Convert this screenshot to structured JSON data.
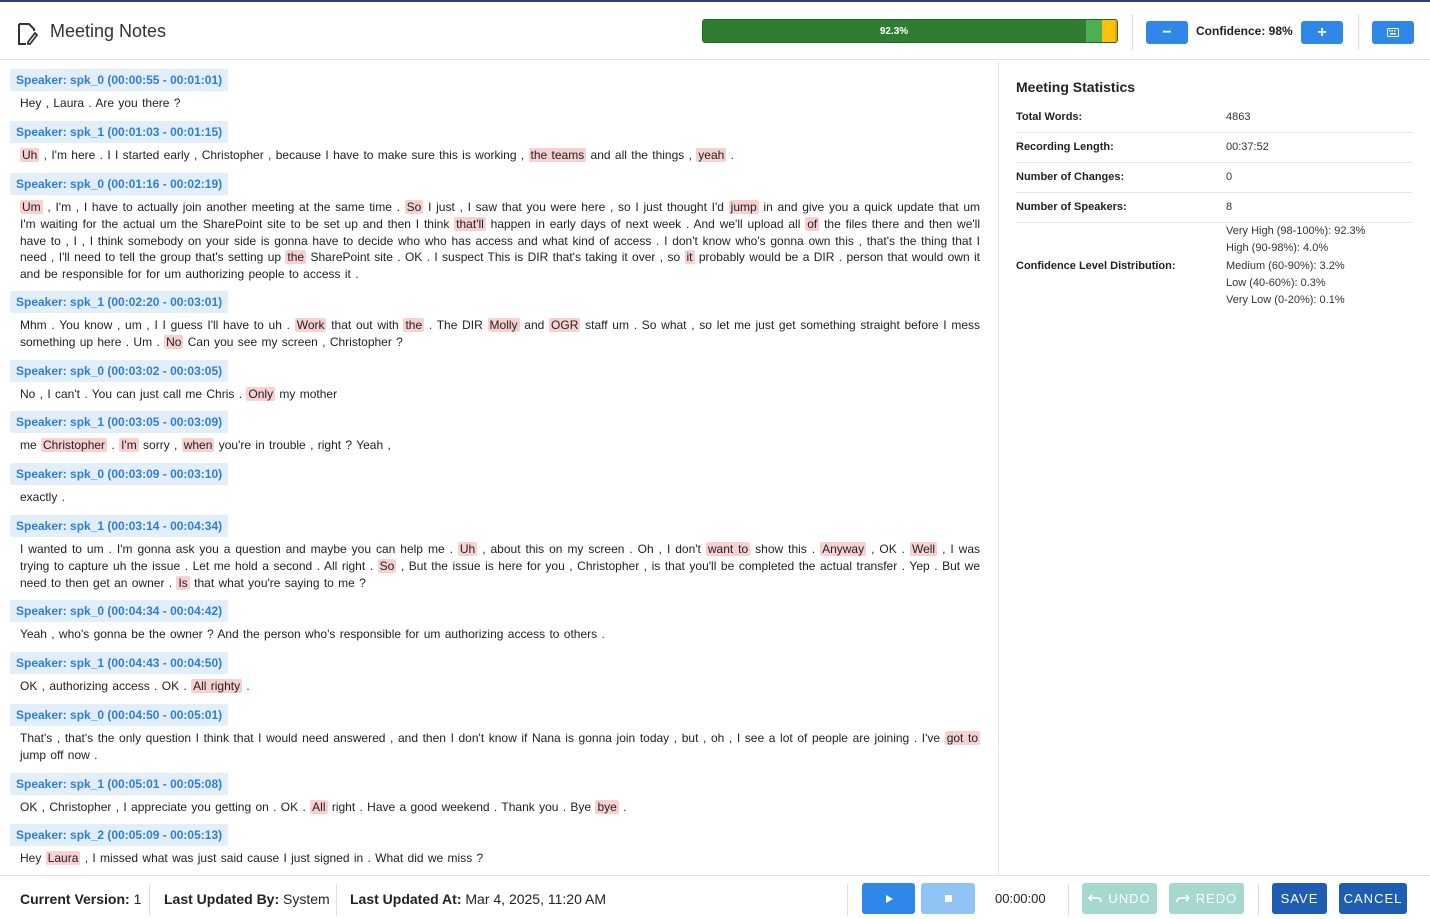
{
  "app": {
    "title": "Meeting Notes",
    "icon": "edit-document-icon"
  },
  "header": {
    "progress_label": "92.3%",
    "distribution_colors": [
      "#2e7d32",
      "#4caf50",
      "#ffc107",
      "#ff9800",
      "#f44336"
    ],
    "confidence_label": "Confidence: 98%",
    "minus_label": "−",
    "plus_label": "+",
    "keyboard_icon": "keyboard-icon"
  },
  "transcript": [
    {
      "speaker": "Speaker: spk_0 (00:00:55 - 00:01:01)",
      "parts": [
        [
          "Hey , Laura . Are you there ?",
          false
        ]
      ]
    },
    {
      "speaker": "Speaker: spk_1 (00:01:03 - 00:01:15)",
      "parts": [
        [
          "Uh",
          true
        ],
        [
          " , I'm here . I I started early , Christopher , because I have to make sure this is working , ",
          false
        ],
        [
          "the teams",
          true
        ],
        [
          " and all the things , ",
          false
        ],
        [
          "yeah",
          true
        ],
        [
          " .",
          false
        ]
      ]
    },
    {
      "speaker": "Speaker: spk_0 (00:01:16 - 00:02:19)",
      "parts": [
        [
          "Um",
          true
        ],
        [
          " , I'm , I have to actually join another meeting at the same time . ",
          false
        ],
        [
          "So",
          true
        ],
        [
          " I just , I saw that you were here , so I just thought I'd ",
          false
        ],
        [
          "jump",
          true
        ],
        [
          " in and give you a quick update that um I'm waiting for the actual um the SharePoint site to be set up and then I think ",
          false
        ],
        [
          "that'll",
          true
        ],
        [
          " happen in early days of next week . And we'll upload all ",
          false
        ],
        [
          "of",
          true
        ],
        [
          " the files there and then we'll have to , I , I think somebody on your side is gonna have to decide who who has access and what kind of access . I don't know who's gonna own this , that's the thing that I need , I'll need to tell the group that's setting up ",
          false
        ],
        [
          "the",
          true
        ],
        [
          " SharePoint site . OK . I suspect This is DIR that's taking it over , so ",
          false
        ],
        [
          "it",
          true
        ],
        [
          " probably would be a DIR . person that would own it and be responsible for for um authorizing people to access it .",
          false
        ]
      ]
    },
    {
      "speaker": "Speaker: spk_1 (00:02:20 - 00:03:01)",
      "parts": [
        [
          "Mhm . You know , um , I I guess I'll have to uh . ",
          false
        ],
        [
          "Work",
          true
        ],
        [
          " that out with ",
          false
        ],
        [
          "the",
          true
        ],
        [
          " . The DIR ",
          false
        ],
        [
          "Molly",
          true
        ],
        [
          " and ",
          false
        ],
        [
          "OGR",
          true
        ],
        [
          " staff um . So what , so let me just get something straight before I mess something up here . Um . ",
          false
        ],
        [
          "No",
          true
        ],
        [
          " Can you see my screen , Christopher ?",
          false
        ]
      ]
    },
    {
      "speaker": "Speaker: spk_0 (00:03:02 - 00:03:05)",
      "parts": [
        [
          "No , I can't . You can just call me Chris . ",
          false
        ],
        [
          "Only",
          true
        ],
        [
          " my mother",
          false
        ]
      ]
    },
    {
      "speaker": "Speaker: spk_1 (00:03:05 - 00:03:09)",
      "parts": [
        [
          "me ",
          false
        ],
        [
          "Christopher",
          true
        ],
        [
          " . ",
          false
        ],
        [
          "I'm",
          true
        ],
        [
          " sorry , ",
          false
        ],
        [
          "when",
          true
        ],
        [
          " you're in trouble , right ? Yeah ,",
          false
        ]
      ]
    },
    {
      "speaker": "Speaker: spk_0 (00:03:09 - 00:03:10)",
      "parts": [
        [
          "exactly .",
          false
        ]
      ]
    },
    {
      "speaker": "Speaker: spk_1 (00:03:14 - 00:04:34)",
      "parts": [
        [
          "I wanted to um . I'm gonna ask you a question and maybe you can help me . ",
          false
        ],
        [
          "Uh",
          true
        ],
        [
          " , about this on my screen . Oh , I don't ",
          false
        ],
        [
          "want to",
          true
        ],
        [
          " show this . ",
          false
        ],
        [
          "Anyway",
          true
        ],
        [
          " , OK . ",
          false
        ],
        [
          "Well",
          true
        ],
        [
          " , I was trying to capture uh the issue . Let me hold a second . All right . ",
          false
        ],
        [
          "So",
          true
        ],
        [
          " , But the issue is here for you , Christopher , is that you'll be completed the actual transfer . Yep . But we need to then get an owner . ",
          false
        ],
        [
          "Is",
          true
        ],
        [
          " that what you're saying to me ?",
          false
        ]
      ]
    },
    {
      "speaker": "Speaker: spk_0 (00:04:34 - 00:04:42)",
      "parts": [
        [
          "Yeah , who's gonna be the owner ? And the person who's responsible for um authorizing access to others .",
          false
        ]
      ]
    },
    {
      "speaker": "Speaker: spk_1 (00:04:43 - 00:04:50)",
      "parts": [
        [
          "OK , authorizing access . OK . ",
          false
        ],
        [
          "All righty",
          true
        ],
        [
          " .",
          false
        ]
      ]
    },
    {
      "speaker": "Speaker: spk_0 (00:04:50 - 00:05:01)",
      "parts": [
        [
          "That's , that's the only question I think that I would need answered , and then I don't know if Nana is gonna join today , but , oh , I see a lot of people are joining . I've ",
          false
        ],
        [
          "got to",
          true
        ],
        [
          " jump off now .",
          false
        ]
      ]
    },
    {
      "speaker": "Speaker: spk_1 (00:05:01 - 00:05:08)",
      "parts": [
        [
          "OK , Christopher , I appreciate you getting on . OK . ",
          false
        ],
        [
          "All",
          true
        ],
        [
          " right . Have a good weekend . Thank you . Bye ",
          false
        ],
        [
          "bye",
          true
        ],
        [
          " .",
          false
        ]
      ]
    },
    {
      "speaker": "Speaker: spk_2 (00:05:09 - 00:05:13)",
      "parts": [
        [
          "Hey ",
          false
        ],
        [
          "Laura",
          true
        ],
        [
          " , I missed what was just said cause I just signed in . What did we miss ?",
          false
        ]
      ]
    }
  ],
  "stats": {
    "title": "Meeting Statistics",
    "total_words_label": "Total Words:",
    "total_words": "4863",
    "recording_length_label": "Recording Length:",
    "recording_length": "00:37:52",
    "changes_label": "Number of Changes:",
    "changes": "0",
    "speakers_label": "Number of Speakers:",
    "speakers": "8",
    "distribution_label": "Confidence Level Distribution:",
    "distribution": [
      "Very High (98-100%): 92.3%",
      "High (90-98%): 4.0%",
      "Medium (60-90%): 3.2%",
      "Low (40-60%): 0.3%",
      "Very Low (0-20%): 0.1%"
    ],
    "distribution_values": [
      92.3,
      4.0,
      3.2,
      0.3,
      0.1
    ]
  },
  "footer": {
    "version_label": "Current Version:",
    "version": "1",
    "updated_by_label": "Last Updated By:",
    "updated_by": "System",
    "updated_at_label": "Last Updated At:",
    "updated_at": "Mar 4, 2025, 11:20 AM",
    "time": "00:00:00",
    "undo": "UNDO",
    "redo": "REDO",
    "save": "SAVE",
    "cancel": "CANCEL"
  }
}
